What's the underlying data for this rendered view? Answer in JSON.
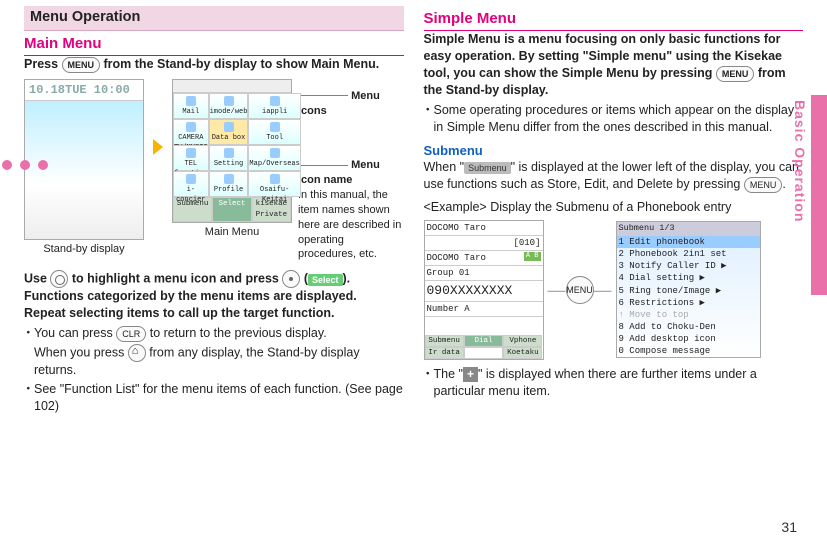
{
  "sideTab": "Basic Operation",
  "pageNumber": "31",
  "left": {
    "sectionBand": "Menu Operation",
    "h2": "Main Menu",
    "press_pre": "Press ",
    "press_key": "MENU",
    "press_post": " from the Stand-by display to show Main Menu.",
    "standby_top": "10.18TUE  10:00",
    "standby_caption": "Stand-by display",
    "mainmenu_caption": "Main Menu",
    "menu_cells": [
      "Mail",
      "imode/web",
      "iappli",
      "CAMERA TV/MUSIC",
      "Data box",
      "Tool",
      "TEL function",
      "Setting",
      "Map/Overseas",
      "i-concier",
      "Profile",
      "Osaifu-Keitai"
    ],
    "soft_left": "Submenu",
    "soft_mid": "Select",
    "soft_right": "kisekae Private",
    "callout1": "Menu icons",
    "callout2": "Menu icon name",
    "callout2_sub": "In this manual, the item names shown here are described in operating procedures, etc.",
    "use1_pre": "Use ",
    "use1_mid1": " to highlight a menu icon and press ",
    "use1_mid2": "(",
    "use1_select": "Select",
    "use1_post": ").",
    "use2": "Functions categorized by the menu items are displayed.",
    "use3": "Repeat selecting items to call up the target function.",
    "b1_pre": "You can press ",
    "b1_key": "CLR",
    "b1_post": " to return to the previous display.",
    "b1_line2_pre": "When you press ",
    "b1_line2_post": " from any display, the Stand-by display returns.",
    "b2": "See \"Function List\" for the menu items of each function. (See page 102)"
  },
  "right": {
    "h2": "Simple Menu",
    "intro_pre": "Simple Menu is a menu focusing on only basic functions for easy operation. By setting \"Simple menu\" using the Kisekae tool, you can show the Simple Menu by pressing ",
    "intro_key": "MENU",
    "intro_post": " from the Stand-by display.",
    "b1": "Some operating procedures or items which appear on the display in Simple Menu differ from the ones described in this manual.",
    "submenu_h": "Submenu",
    "sub_pre": "When \"",
    "sub_label": "Submenu",
    "sub_mid": "\" is displayed at the lower left of the display, you can use functions such as Store, Edit, and Delete by pressing ",
    "sub_key": "MENU",
    "sub_post": ".",
    "example_label": "<Example> Display the Submenu of a Phonebook entry",
    "pb_title": "DOCOMO Taro",
    "pb_idx": "[010]",
    "pb_name2": "DOCOMO Taro",
    "pb_group": "Group 01",
    "pb_num": "090XXXXXXXX",
    "pb_numlabel": "Number A",
    "pb_soft_l": "Submenu",
    "pb_soft_m": "Dial",
    "pb_soft_r1": "Vphone",
    "pb_soft_r2": "Koetaku",
    "pb_ir": "Ir data",
    "menu_btn": "MENU",
    "submenu_hdr": "Submenu        1/3",
    "submenu_items": [
      {
        "t": "1 Edit phonebook",
        "hl": true
      },
      {
        "t": "2 Phonebook 2in1 set"
      },
      {
        "t": "3 Notify Caller ID ▶"
      },
      {
        "t": "4 Dial setting    ▶"
      },
      {
        "t": "5 Ring tone/Image ▶"
      },
      {
        "t": "6 Restrictions    ▶"
      },
      {
        "t": "↑ Move to top",
        "gray": true
      },
      {
        "t": "8 Add to Choku-Den"
      },
      {
        "t": "9 Add desktop icon"
      },
      {
        "t": "0 Compose message"
      }
    ],
    "plus_pre": "The \"",
    "plus_post": "\" is displayed when there are further items under a particular menu item."
  }
}
